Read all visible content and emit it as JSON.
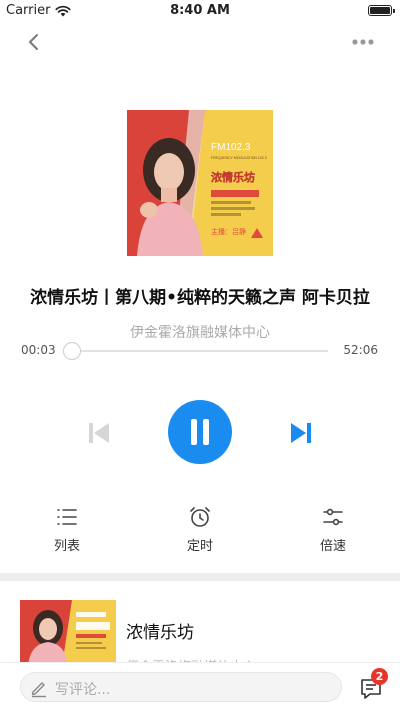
{
  "status_bar": {
    "carrier": "Carrier",
    "time": "8:40 AM"
  },
  "nav": {
    "back_icon": "chevron-left-icon",
    "more_icon": "more-horizontal-icon"
  },
  "cover_art": {
    "frequency": "FM102.3",
    "modulation": "FREQUENCY MODULATION 102.3",
    "program": "浓情乐坊",
    "host": "主播：吕静"
  },
  "track": {
    "title": "浓情乐坊丨第八期•纯粹的天籁之声 阿卡贝拉",
    "artist": "伊金霍洛旗融媒体中心"
  },
  "progress": {
    "current": "00:03",
    "duration": "52:06",
    "fraction": 0.001
  },
  "controls": {
    "prev_icon": "skip-previous-icon",
    "play_icon": "pause-icon",
    "next_icon": "skip-next-icon"
  },
  "tools": [
    {
      "label": "列表",
      "icon": "list-icon"
    },
    {
      "label": "定时",
      "icon": "alarm-clock-icon"
    },
    {
      "label": "倍速",
      "icon": "sliders-icon"
    }
  ],
  "album": {
    "name": "浓情乐坊",
    "subtitle": "伊金霍洛旗融媒体中心"
  },
  "comment": {
    "placeholder": "写评论...",
    "badge_count": "2"
  },
  "colors": {
    "accent": "#1a8cf0",
    "badge": "#e8352b",
    "cover_yellow": "#f5cd4c",
    "cover_red": "#d9433a"
  }
}
